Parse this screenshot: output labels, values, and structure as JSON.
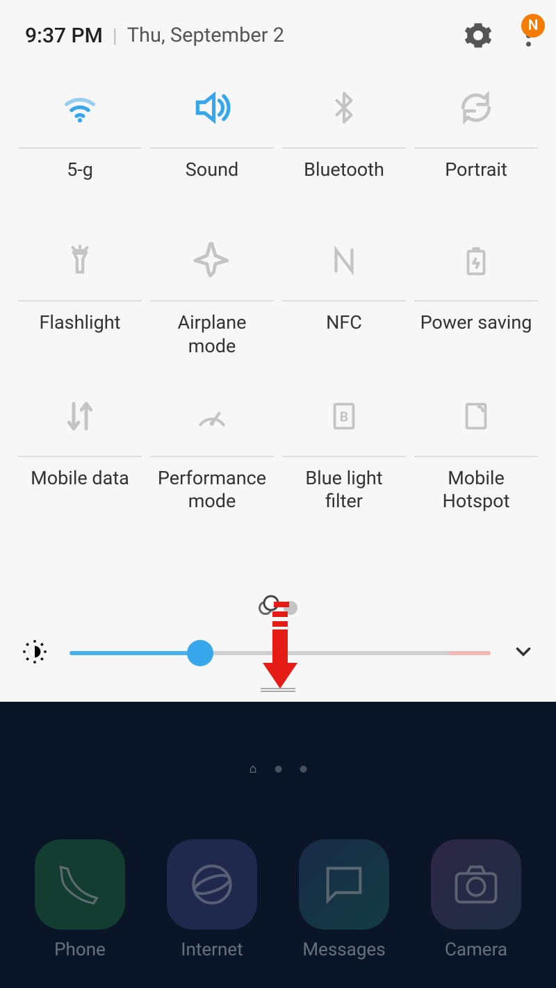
{
  "header": {
    "time": "9:37 PM",
    "date": "Thu, September 2",
    "badge": "N"
  },
  "tiles": [
    {
      "id": "wifi",
      "label": "5-g",
      "active": true,
      "icon": "wifi-icon"
    },
    {
      "id": "sound",
      "label": "Sound",
      "active": true,
      "icon": "sound-icon"
    },
    {
      "id": "bluetooth",
      "label": "Bluetooth",
      "active": false,
      "icon": "bluetooth-icon"
    },
    {
      "id": "rotation",
      "label": "Portrait",
      "active": false,
      "icon": "rotation-icon"
    },
    {
      "id": "flashlight",
      "label": "Flashlight",
      "active": false,
      "icon": "flashlight-icon"
    },
    {
      "id": "airplane",
      "label": "Airplane mode",
      "active": false,
      "icon": "airplane-icon"
    },
    {
      "id": "nfc",
      "label": "NFC",
      "active": false,
      "icon": "nfc-icon"
    },
    {
      "id": "power",
      "label": "Power saving",
      "active": false,
      "icon": "power-saving-icon"
    },
    {
      "id": "mobiledata",
      "label": "Mobile data",
      "active": false,
      "icon": "mobile-data-icon"
    },
    {
      "id": "performance",
      "label": "Performance mode",
      "active": false,
      "icon": "performance-icon"
    },
    {
      "id": "bluelight",
      "label": "Blue light filter",
      "active": false,
      "icon": "blue-light-icon"
    },
    {
      "id": "hotspot",
      "label": "Mobile Hotspot",
      "active": false,
      "icon": "hotspot-icon"
    }
  ],
  "brightness": {
    "percent": 31
  },
  "dock": [
    {
      "id": "phone",
      "label": "Phone"
    },
    {
      "id": "internet",
      "label": "Internet"
    },
    {
      "id": "messages",
      "label": "Messages"
    },
    {
      "id": "camera",
      "label": "Camera"
    }
  ]
}
